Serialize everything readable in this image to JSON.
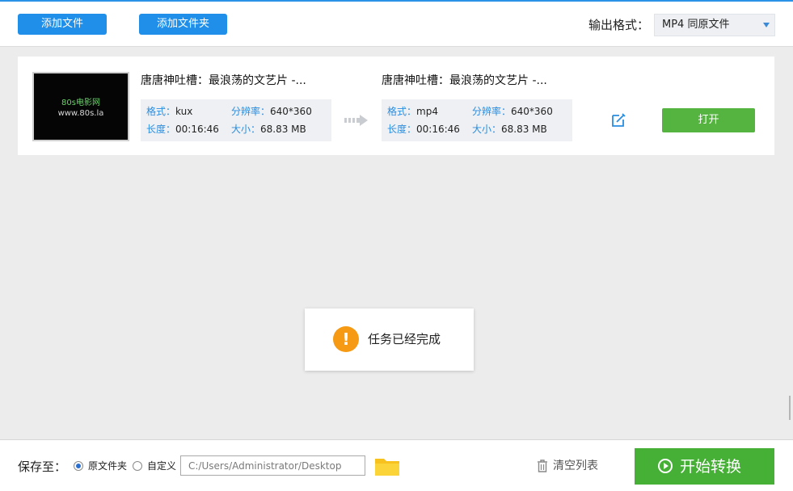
{
  "toolbar": {
    "add_file": "添加文件",
    "add_folder": "添加文件夹",
    "output_format_label": "输出格式：",
    "output_format_value": "MP4  同原文件"
  },
  "file": {
    "thumbnail": {
      "line1": "80s电影网",
      "line2": "www.80s.la"
    },
    "source": {
      "name": "唐唐神吐槽：最浪荡的文艺片 -...",
      "format_key": "格式：",
      "format_val": "kux",
      "resolution_key": "分辨率：",
      "resolution_val": "640*360",
      "duration_key": "长度：",
      "duration_val": "00:16:46",
      "size_key": "大小：",
      "size_val": "68.83 MB"
    },
    "target": {
      "name": "唐唐神吐槽：最浪荡的文艺片 -...",
      "format_key": "格式：",
      "format_val": "mp4",
      "resolution_key": "分辨率：",
      "resolution_val": "640*360",
      "duration_key": "长度：",
      "duration_val": "00:16:46",
      "size_key": "大小：",
      "size_val": "68.83 MB"
    },
    "open_label": "打开"
  },
  "toast": {
    "icon": "warning-icon",
    "message": "任务已经完成"
  },
  "footer": {
    "save_to_label": "保存至：",
    "option_original": "原文件夹",
    "option_custom": "自定义",
    "selected_option": "原文件夹",
    "path_value": "C:/Users/Administrator/Desktop",
    "clear_list_label": "清空列表",
    "start_label": "开始转换"
  },
  "colors": {
    "accent_blue": "#1f8fe9",
    "open_green": "#55b340",
    "start_green": "#45b035",
    "warning_orange": "#f59a12"
  }
}
